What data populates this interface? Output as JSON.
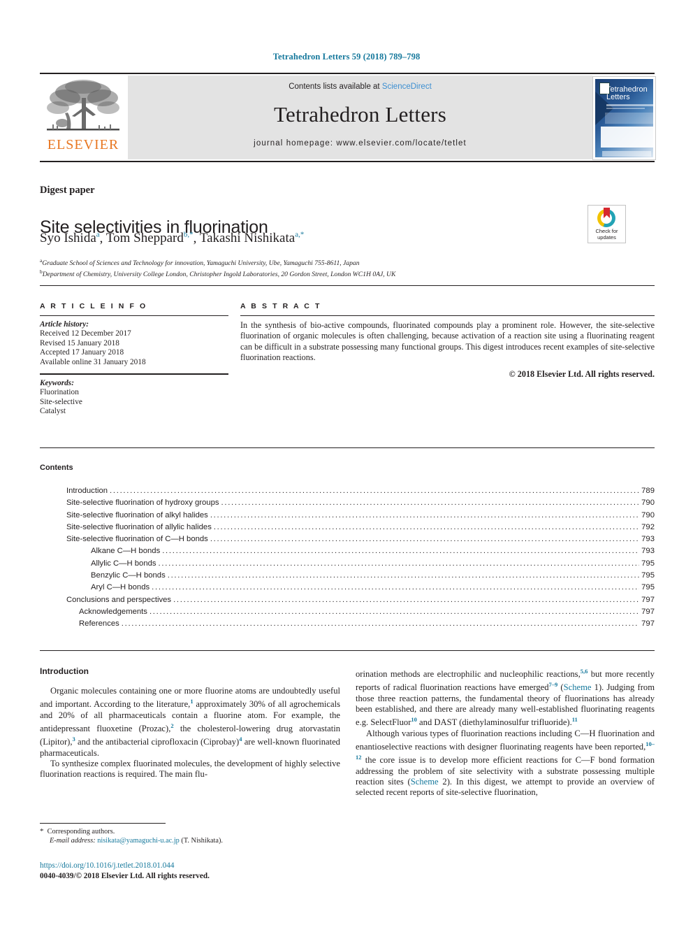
{
  "running_head": "Tetrahedron Letters 59 (2018) 789–798",
  "masthead": {
    "contents_prefix": "Contents lists available at ",
    "sciencedirect": "ScienceDirect",
    "journal_name": "Tetrahedron Letters",
    "homepage": "journal homepage: www.elsevier.com/locate/tetlet",
    "publisher_wordmark": "ELSEVIER",
    "cover_title": "Tetrahedron Letters"
  },
  "article": {
    "type_label": "Digest paper",
    "title": "Site selectivities in fluorination",
    "authors_plain": "Syo Ishida a, Tom Sheppard b,*, Takashi Nishikata a,*",
    "affiliation_a": "Graduate School of Sciences and Technology for innovation, Yamaguchi University, Ube, Yamaguchi 755-8611, Japan",
    "affiliation_b": "Department of Chemistry, University College London, Christopher Ingold Laboratories, 20 Gordon Street, London WC1H 0AJ, UK"
  },
  "crossmark": {
    "line1": "Check for",
    "line2": "updates"
  },
  "info": {
    "heading": "A R T I C L E   I N F O",
    "history_label": "Article history:",
    "history": [
      "Received 12 December 2017",
      "Revised 15 January 2018",
      "Accepted 17 January 2018",
      "Available online 31 January 2018"
    ],
    "keywords_label": "Keywords:",
    "keywords": [
      "Fluorination",
      "Site-selective",
      "Catalyst"
    ]
  },
  "abstract": {
    "heading": "A B S T R A C T",
    "text": "In the synthesis of bio-active compounds, fluorinated compounds play a prominent role. However, the site-selective fluorination of organic molecules is often challenging, because activation of a reaction site using a fluorinating reagent can be difficult in a substrate possessing many functional groups. This digest introduces recent examples of site-selective fluorination reactions.",
    "copyright": "© 2018 Elsevier Ltd. All rights reserved."
  },
  "contents": {
    "heading": "Contents",
    "entries": [
      {
        "label": "Introduction",
        "page": "789",
        "indent": 0
      },
      {
        "label": "Site-selective fluorination of hydroxy groups",
        "page": "790",
        "indent": 0
      },
      {
        "label": "Site-selective fluorination of alkyl halides",
        "page": "790",
        "indent": 0
      },
      {
        "label": "Site-selective fluorination of allylic halides",
        "page": "792",
        "indent": 0
      },
      {
        "label": "Site-selective fluorination of C—H bonds",
        "page": "793",
        "indent": 0
      },
      {
        "label": "Alkane C—H bonds",
        "page": "793",
        "indent": 1
      },
      {
        "label": "Allylic C—H bonds",
        "page": "795",
        "indent": 1
      },
      {
        "label": "Benzylic C—H bonds",
        "page": "795",
        "indent": 1
      },
      {
        "label": "Aryl C—H bonds",
        "page": "795",
        "indent": 1
      },
      {
        "label": "Conclusions and perspectives",
        "page": "797",
        "indent": 0
      },
      {
        "label": "Acknowledgements",
        "page": "797",
        "indent": 2
      },
      {
        "label": "References",
        "page": "797",
        "indent": 2
      }
    ]
  },
  "body": {
    "intro_heading": "Introduction",
    "left_p1_a": "Organic molecules containing one or more fluorine atoms are undoubtedly useful and important. According to the literature,",
    "left_p1_ref1": "1",
    "left_p1_b": " approximately 30% of all agrochemicals and 20% of all pharmaceuticals contain a fluorine atom. For example, the antidepressant fluoxetine (Prozac),",
    "left_p1_ref2": "2",
    "left_p1_c": " the cholesterol-lowering drug atorvastatin (Lipitor),",
    "left_p1_ref3": "3",
    "left_p1_d": " and the antibacterial ciprofloxacin (Ciprobay)",
    "left_p1_ref4": "4",
    "left_p1_e": " are well-known fluorinated pharmaceuticals.",
    "left_p2": "To synthesize complex fluorinated molecules, the development of highly selective fluorination reactions is required. The main flu-",
    "right_p1_a": "orination methods are electrophilic and nucleophilic reactions,",
    "right_p1_ref1": "5,6",
    "right_p1_b": " but more recently reports of radical fluorination reactions have emerged",
    "right_p1_ref2": "7–9",
    "right_p1_c": " (",
    "right_p1_link1": "Scheme",
    "right_p1_d": " 1). Judging from those three reaction patterns, the fundamental theory of fluorinations has already been established, and there are already many well-established fluorinating reagents e.g. SelectFluor",
    "right_p1_ref3": "10",
    "right_p1_e": " and DAST (diethylaminosulfur trifluoride).",
    "right_p1_ref4": "11",
    "right_p2_a": "Although various types of fluorination reactions including C—H fluorination and enantioselective reactions with designer fluorinating reagents have been reported,",
    "right_p2_ref1": "10–12",
    "right_p2_b": " the core issue is to develop more efficient reactions for C—F bond formation addressing the problem of site selectivity with a substrate possessing multiple reaction sites (",
    "right_p2_link1": "Scheme",
    "right_p2_c": " 2). In this digest, we attempt to provide an overview of selected recent reports of site-selective fluorination,"
  },
  "footer": {
    "corresponding": "Corresponding authors.",
    "email_label": "E-mail address:",
    "email": "nisikata@yamaguchi-u.ac.jp",
    "email_suffix": " (T. Nishikata).",
    "doi": "https://doi.org/10.1016/j.tetlet.2018.01.044",
    "issn": "0040-4039/© 2018 Elsevier Ltd. All rights reserved."
  },
  "colors": {
    "link_blue": "#15789c",
    "sciencedirect_blue": "#3d8fd1",
    "elsevier_orange": "#e87722",
    "text": "#231f20"
  }
}
